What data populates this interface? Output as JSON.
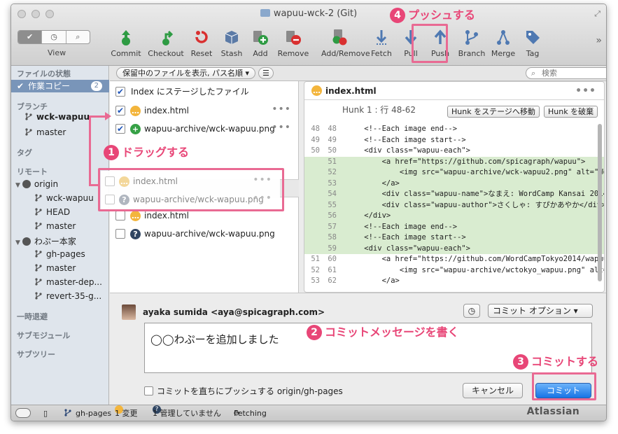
{
  "window": {
    "title": "wapuu-wck-2 (Git)"
  },
  "toolbar": {
    "view_label": "View",
    "buttons": [
      {
        "id": "commit",
        "label": "Commit",
        "color": "#2e9b43"
      },
      {
        "id": "checkout",
        "label": "Checkout",
        "color": "#2e9b43"
      },
      {
        "id": "reset",
        "label": "Reset",
        "color": "#d93030"
      },
      {
        "id": "stash",
        "label": "Stash",
        "color": "#5b7aa6"
      },
      {
        "id": "add",
        "label": "Add",
        "color": "#2e9b43"
      },
      {
        "id": "remove",
        "label": "Remove",
        "color": "#d93030"
      },
      {
        "id": "add_remove",
        "label": "Add/Remove",
        "color": "#2e9b43"
      },
      {
        "id": "fetch",
        "label": "Fetch",
        "color": "#4f79b2"
      },
      {
        "id": "pull",
        "label": "Pull",
        "color": "#4f79b2"
      },
      {
        "id": "push",
        "label": "Push",
        "color": "#4f79b2"
      },
      {
        "id": "branch",
        "label": "Branch",
        "color": "#4f79b2"
      },
      {
        "id": "merge",
        "label": "Merge",
        "color": "#4f79b2"
      },
      {
        "id": "tag",
        "label": "Tag",
        "color": "#4f79b2"
      }
    ]
  },
  "sidebar": {
    "file_status": "ファイルの状態",
    "working_copy": "作業コピー",
    "working_copy_count": "2",
    "branches_header": "ブランチ",
    "branches": [
      "wck-wapuu",
      "master"
    ],
    "tags_header": "タグ",
    "remotes_header": "リモート",
    "remotes": [
      {
        "name": "origin",
        "branches": [
          "wck-wapuu",
          "HEAD",
          "master"
        ]
      },
      {
        "name": "わぷー本家",
        "branches": [
          "gh-pages",
          "master",
          "master-dep...",
          "revert-35-g..."
        ]
      }
    ],
    "stashes_header": "一時退避",
    "submodules_header": "サブモジュール",
    "subtrees_header": "サブツリー"
  },
  "filterbar": {
    "filter_label": "保留中のファイルを表示, パス名順",
    "search_placeholder": "検索"
  },
  "files": {
    "staged_header": "Index にステージしたファイル",
    "staged": [
      {
        "name": "index.html",
        "status": "…",
        "status_color": "#f3b53c"
      },
      {
        "name": "wapuu-archive/wck-wapuu.png",
        "status": "+",
        "status_color": "#36a146"
      }
    ],
    "unstaged": [
      {
        "name": "index.html",
        "status": "…",
        "status_color": "#f3b53c"
      },
      {
        "name": "wapuu-archive/wck-wapuu.png",
        "status": "?",
        "status_color": "#2f4562"
      }
    ],
    "dragging": [
      {
        "name": "index.html",
        "status": "…",
        "status_color": "#f3d79a"
      },
      {
        "name": "wapuu-archive/wck-wapuu.png",
        "status": "?",
        "status_color": "#b0b6bf"
      }
    ]
  },
  "diff": {
    "filename": "index.html",
    "hunk_label": "Hunk 1 : 行 48-62",
    "stage_hunk": "Hunk をステージへ移動",
    "discard_hunk": "Hunk を破棄",
    "lines": [
      {
        "old": "48",
        "new": "48",
        "type": "ctx",
        "code": "    <!--Each image end-->"
      },
      {
        "old": "49",
        "new": "49",
        "type": "ctx",
        "code": "    <!--Each image start-->"
      },
      {
        "old": "50",
        "new": "50",
        "type": "ctx",
        "code": "    <div class=\"wapuu-each\">"
      },
      {
        "old": "",
        "new": "51",
        "type": "add",
        "code": "        <a href=\"https://github.com/spicagraph/wapuu\">"
      },
      {
        "old": "",
        "new": "52",
        "type": "add",
        "code": "            <img src=\"wapuu-archive/wck-wapuu2.png\" alt=\"WordC"
      },
      {
        "old": "",
        "new": "53",
        "type": "add",
        "code": "        </a>"
      },
      {
        "old": "",
        "new": "54",
        "type": "add",
        "code": "        <div class=\"wapuu-name\">なまえ: WordCamp Kansai 2014わぷ"
      },
      {
        "old": "",
        "new": "55",
        "type": "add",
        "code": "        <div class=\"wapuu-author\">さくしゃ: すぴかあやか</div>"
      },
      {
        "old": "",
        "new": "56",
        "type": "add",
        "code": "    </div>"
      },
      {
        "old": "",
        "new": "57",
        "type": "add",
        "code": "    <!--Each image end-->"
      },
      {
        "old": "",
        "new": "58",
        "type": "add",
        "code": "    <!--Each image start-->"
      },
      {
        "old": "",
        "new": "59",
        "type": "add",
        "code": "    <div class=\"wapuu-each\">"
      },
      {
        "old": "51",
        "new": "60",
        "type": "ctx",
        "code": "        <a href=\"https://github.com/WordCampTokyo2014/wapuu\">"
      },
      {
        "old": "52",
        "new": "61",
        "type": "ctx",
        "code": "            <img src=\"wapuu-archive/wctokyo_wapuu.png\" alt=\"メ"
      },
      {
        "old": "53",
        "new": "62",
        "type": "ctx",
        "code": "        </a>"
      }
    ]
  },
  "commit": {
    "author": "ayaka sumida <aya@spicagraph.com>",
    "options": "コミット オプション",
    "message": "◯◯わぷーを追加しました",
    "push_immediately": "コミットを直ちにプッシュする origin/gh-pages",
    "cancel": "キャンセル",
    "commit": "コミット"
  },
  "status": {
    "branch": "gh-pages",
    "changed": "1 変更",
    "untracked": "1 管理していません",
    "activity": "Fetching",
    "logo": "Atlassian"
  },
  "annotations": {
    "drag": "ドラッグする",
    "write": "コミットメッセージを書く",
    "commit": "コミットする",
    "push": "プッシュする",
    "n1": "1",
    "n2": "2",
    "n3": "3",
    "n4": "4",
    "color": "#e84677"
  }
}
